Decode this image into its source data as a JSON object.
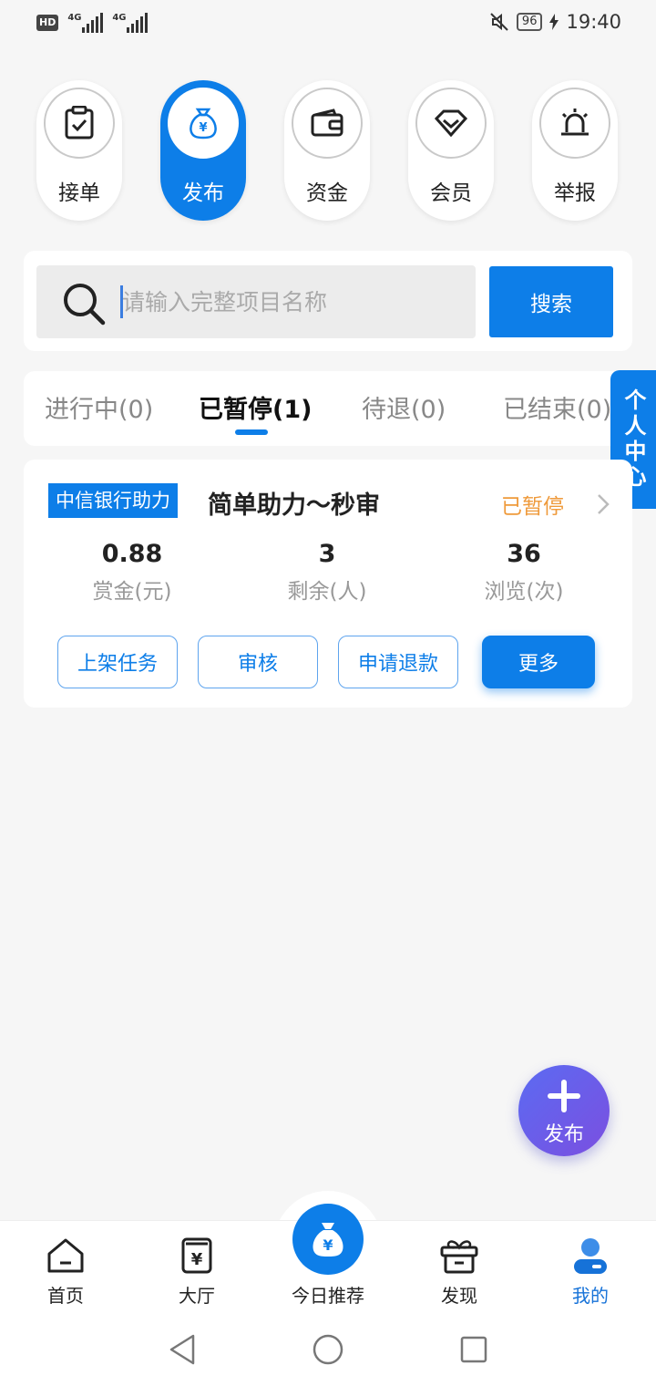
{
  "status_bar": {
    "hd": "HD",
    "net1": "4G",
    "net2": "4G",
    "battery": "96",
    "time": "19:40"
  },
  "top_menu": [
    {
      "label": "接单",
      "icon": "clipboard-check-icon"
    },
    {
      "label": "发布",
      "icon": "money-bag-icon",
      "active": true
    },
    {
      "label": "资金",
      "icon": "wallet-icon"
    },
    {
      "label": "会员",
      "icon": "diamond-icon"
    },
    {
      "label": "举报",
      "icon": "alarm-icon"
    }
  ],
  "search": {
    "placeholder": "请输入完整项目名称",
    "button_label": "搜索"
  },
  "tabs": [
    {
      "label": "进行中(0)"
    },
    {
      "label": "已暂停(1)",
      "active": true
    },
    {
      "label": "待退(0)"
    },
    {
      "label": "已结束(0)"
    }
  ],
  "side_button": {
    "label": "个人中心"
  },
  "task": {
    "tag": "中信银行助力",
    "title": "简单助力～秒审",
    "status": "已暂停",
    "stats": [
      {
        "value": "0.88",
        "label": "赏金(元)"
      },
      {
        "value": "3",
        "label": "剩余(人)"
      },
      {
        "value": "36",
        "label": "浏览(次)"
      }
    ],
    "actions": [
      "上架任务",
      "审核",
      "申请退款",
      "更多"
    ]
  },
  "fab": {
    "label": "发布"
  },
  "bottom_nav": [
    {
      "label": "首页",
      "icon": "home-icon"
    },
    {
      "label": "大厅",
      "icon": "yuan-receipt-icon"
    },
    {
      "label": "今日推荐",
      "icon": "money-bag-icon"
    },
    {
      "label": "发现",
      "icon": "gift-box-icon"
    },
    {
      "label": "我的",
      "icon": "user-icon",
      "active": true
    }
  ],
  "colors": {
    "primary": "#0d7ee8",
    "status_paused": "#ef9a3b",
    "fab_gradient_start": "#5b6bf2",
    "fab_gradient_end": "#7b4fe0"
  }
}
